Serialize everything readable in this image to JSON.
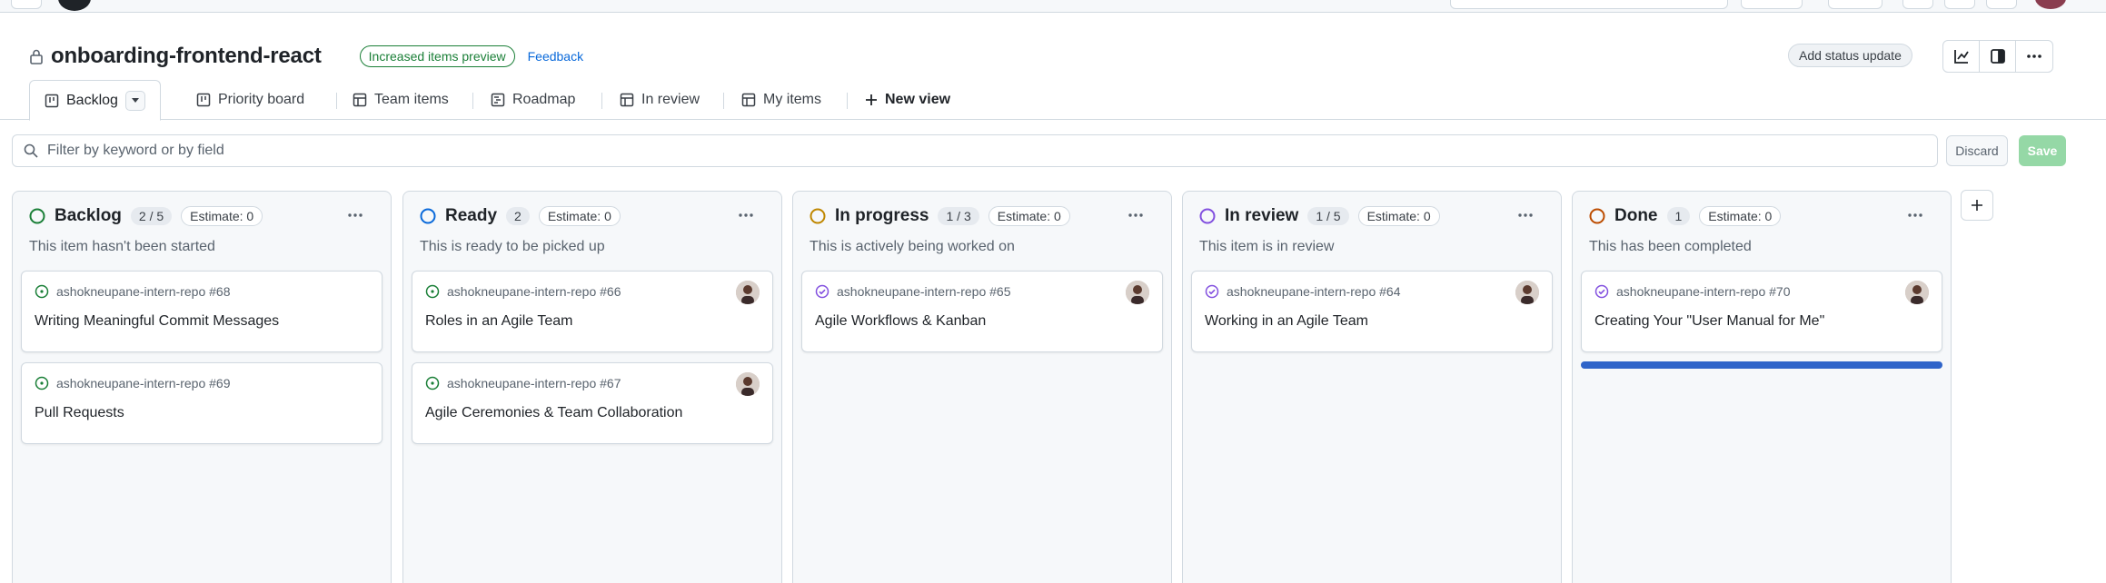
{
  "project": {
    "title": "onboarding-frontend-react",
    "preview_badge": "Increased items preview",
    "feedback": "Feedback",
    "status_button": "Add status update"
  },
  "views": [
    {
      "label": "Backlog",
      "icon": "board-icon"
    },
    {
      "label": "Priority board",
      "icon": "board-icon"
    },
    {
      "label": "Team items",
      "icon": "table-icon"
    },
    {
      "label": "Roadmap",
      "icon": "roadmap-icon"
    },
    {
      "label": "In review",
      "icon": "table-icon"
    },
    {
      "label": "My items",
      "icon": "table-icon"
    },
    {
      "label": "New view",
      "icon": "plus-icon"
    }
  ],
  "filter": {
    "placeholder": "Filter by keyword or by field",
    "discard": "Discard",
    "save": "Save"
  },
  "columns": [
    {
      "name": "Backlog",
      "count": "2 / 5",
      "estimate": "Estimate: 0",
      "description": "This item hasn't been started",
      "status_color": "#1a7f37",
      "cards": [
        {
          "repo": "ashokneupane-intern-repo #68",
          "title": "Writing Meaningful Commit Messages",
          "state": "open",
          "avatar": false
        },
        {
          "repo": "ashokneupane-intern-repo #69",
          "title": "Pull Requests",
          "state": "open",
          "avatar": false
        }
      ]
    },
    {
      "name": "Ready",
      "count": "2",
      "estimate": "Estimate: 0",
      "description": "This is ready to be picked up",
      "status_color": "#0969da",
      "cards": [
        {
          "repo": "ashokneupane-intern-repo #66",
          "title": "Roles in an Agile Team",
          "state": "open",
          "avatar": true
        },
        {
          "repo": "ashokneupane-intern-repo #67",
          "title": "Agile Ceremonies & Team Collaboration",
          "state": "open",
          "avatar": true
        }
      ]
    },
    {
      "name": "In progress",
      "count": "1 / 3",
      "estimate": "Estimate: 0",
      "description": "This is actively being worked on",
      "status_color": "#bf8700",
      "cards": [
        {
          "repo": "ashokneupane-intern-repo #65",
          "title": "Agile Workflows & Kanban",
          "state": "closed",
          "avatar": true
        }
      ]
    },
    {
      "name": "In review",
      "count": "1 / 5",
      "estimate": "Estimate: 0",
      "description": "This item is in review",
      "status_color": "#8250df",
      "cards": [
        {
          "repo": "ashokneupane-intern-repo #64",
          "title": "Working in an Agile Team",
          "state": "closed",
          "avatar": true
        }
      ]
    },
    {
      "name": "Done",
      "count": "1",
      "estimate": "Estimate: 0",
      "description": "This has been completed",
      "status_color": "#bc4c00",
      "cards": [
        {
          "repo": "ashokneupane-intern-repo #70",
          "title": "Creating Your \"User Manual for Me\"",
          "state": "closed",
          "avatar": true
        }
      ]
    }
  ],
  "colors": {
    "open_issue": "#1a7f37",
    "closed_issue": "#8250df",
    "drop_indicator": "#2f64c9"
  }
}
